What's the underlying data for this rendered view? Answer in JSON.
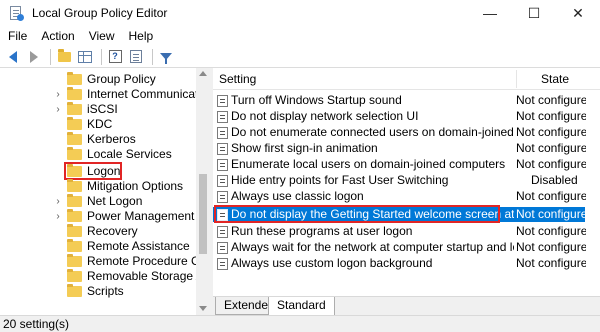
{
  "window": {
    "title": "Local Group Policy Editor",
    "minimize": "—",
    "maximize": "☐",
    "close": "✕"
  },
  "menu": [
    "File",
    "Action",
    "View",
    "Help"
  ],
  "toolbar": {
    "icons": [
      "back-arrow-icon",
      "forward-arrow-icon",
      "up-folder-icon",
      "show-hide-tree-icon",
      "help-icon",
      "properties-icon",
      "filter-icon"
    ]
  },
  "tree": {
    "items": [
      {
        "label": "Group Policy",
        "expander": ""
      },
      {
        "label": "Internet Communication",
        "expander": "›"
      },
      {
        "label": "iSCSI",
        "expander": "›"
      },
      {
        "label": "KDC",
        "expander": ""
      },
      {
        "label": "Kerberos",
        "expander": ""
      },
      {
        "label": "Locale Services",
        "expander": ""
      },
      {
        "label": "Logon",
        "expander": ""
      },
      {
        "label": "Mitigation Options",
        "expander": ""
      },
      {
        "label": "Net Logon",
        "expander": "›"
      },
      {
        "label": "Power Management",
        "expander": "›"
      },
      {
        "label": "Recovery",
        "expander": ""
      },
      {
        "label": "Remote Assistance",
        "expander": ""
      },
      {
        "label": "Remote Procedure Call",
        "expander": ""
      },
      {
        "label": "Removable Storage Access",
        "expander": ""
      },
      {
        "label": "Scripts",
        "expander": ""
      }
    ],
    "selected": "Logon"
  },
  "list": {
    "col_setting": "Setting",
    "col_state": "State",
    "rows": [
      {
        "name": "Turn off Windows Startup sound",
        "state": "Not configured"
      },
      {
        "name": "Do not display network selection UI",
        "state": "Not configured"
      },
      {
        "name": "Do not enumerate connected users on domain-joined computers",
        "state": "Not configured"
      },
      {
        "name": "Show first sign-in animation",
        "state": "Not configured"
      },
      {
        "name": "Enumerate local users on domain-joined computers",
        "state": "Not configured"
      },
      {
        "name": "Hide entry points for Fast User Switching",
        "state": "Disabled"
      },
      {
        "name": "Always use classic logon",
        "state": "Not configured"
      },
      {
        "name": "Do not display the Getting Started welcome screen at logon",
        "state": "Not configured"
      },
      {
        "name": "Run these programs at user logon",
        "state": "Not configured"
      },
      {
        "name": "Always wait for the network at computer startup and logon",
        "state": "Not configured"
      },
      {
        "name": "Always use custom logon background",
        "state": "Not configured"
      }
    ],
    "selected_index": 7
  },
  "tabs": {
    "extended": "Extended",
    "standard": "Standard"
  },
  "status": {
    "text": "20 setting(s)"
  },
  "colors": {
    "selection": "#0078d7",
    "highlight_box": "#e12525",
    "folder": "#f4cc55"
  }
}
